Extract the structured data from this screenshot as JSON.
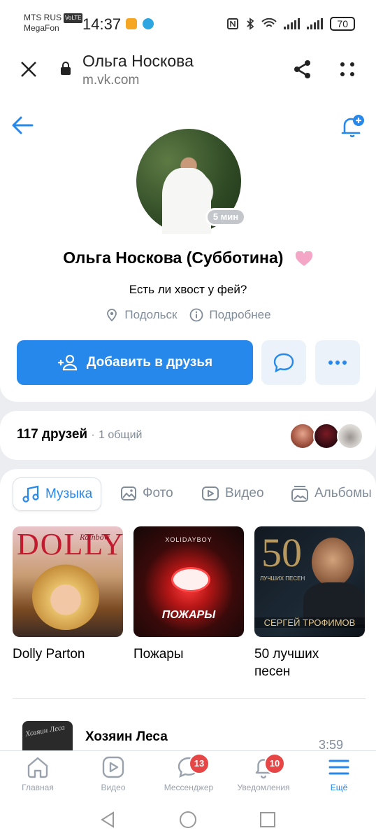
{
  "status_bar": {
    "carrier1": "MTS RUS",
    "volte": "VoLTE",
    "carrier2": "MegaFon",
    "time": "14:37",
    "battery": "70"
  },
  "browser": {
    "title": "Ольга Носкова",
    "url": "m.vk.com"
  },
  "profile": {
    "online_badge": "5 мин",
    "name": "Ольга Носкова (Субботина)",
    "status": "Есть ли хвост у фей?",
    "city": "Подольск",
    "details": "Подробнее",
    "add_friend": "Добавить в друзья"
  },
  "friends": {
    "count_text": "117 друзей",
    "separator": "·",
    "common_text": "1 общий"
  },
  "tabs": [
    {
      "label": "Музыка"
    },
    {
      "label": "Фото"
    },
    {
      "label": "Видео"
    },
    {
      "label": "Альбомы"
    }
  ],
  "albums": [
    {
      "cover_text": "DOLLY",
      "cover_sub": "Rainbow",
      "caption": "Dolly Parton"
    },
    {
      "cover_text": "ПОЖАРЫ",
      "cover_sub": "XOLIDAYBOY",
      "caption": "Пожары"
    },
    {
      "cover_text": "50",
      "cover_sub": "ЛУЧШИХ ПЕСЕН",
      "cover_bottom": "СЕРГЕЙ ТРОФИМОВ",
      "caption_line1": "50 лучших",
      "caption_line2": "песен"
    }
  ],
  "track": {
    "cover_text": "Хозяин Леса",
    "title": "Хозяин Леса",
    "duration": "3:59"
  },
  "tabbar": [
    {
      "label": "Главная",
      "icon": "home-icon"
    },
    {
      "label": "Видео",
      "icon": "video-icon"
    },
    {
      "label": "Мессенджер",
      "icon": "messenger-icon",
      "badge": "13"
    },
    {
      "label": "Уведомления",
      "icon": "bell-icon",
      "badge": "10"
    },
    {
      "label": "Ещё",
      "icon": "menu-icon"
    }
  ],
  "colors": {
    "accent": "#2688eb",
    "badge": "#e64646",
    "muted": "#818c99"
  }
}
